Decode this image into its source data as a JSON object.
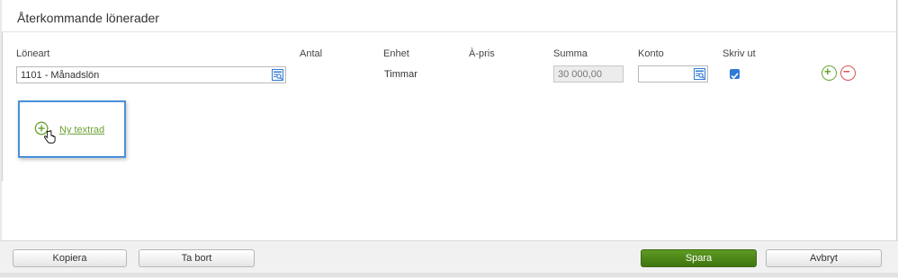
{
  "panel": {
    "title": "Återkommande lönerader"
  },
  "columns": {
    "loneart": "Löneart",
    "antal": "Antal",
    "enhet": "Enhet",
    "apris": "À-pris",
    "summa": "Summa",
    "konto": "Konto",
    "skriv_ut": "Skriv ut"
  },
  "row": {
    "loneart_value": "1101 - Månadslön",
    "enhet_value": "Timmar",
    "summa_value": "30 000,00",
    "konto_value": "",
    "skriv_ut_checked": true
  },
  "add_text_row": {
    "label": "Ny textrad"
  },
  "footer": {
    "copy": "Kopiera",
    "delete": "Ta bort",
    "save": "Spara",
    "cancel": "Avbryt"
  },
  "colors": {
    "primary_green": "#4a8a1a",
    "add_green": "#6aa332",
    "remove_red": "#d9534f",
    "checkbox_blue": "#2f7ad3",
    "highlight_blue": "#4a90d9"
  },
  "icons": [
    "lookup-icon",
    "checkmark-icon",
    "plus-circle-icon",
    "minus-circle-icon",
    "hand-cursor-icon"
  ]
}
